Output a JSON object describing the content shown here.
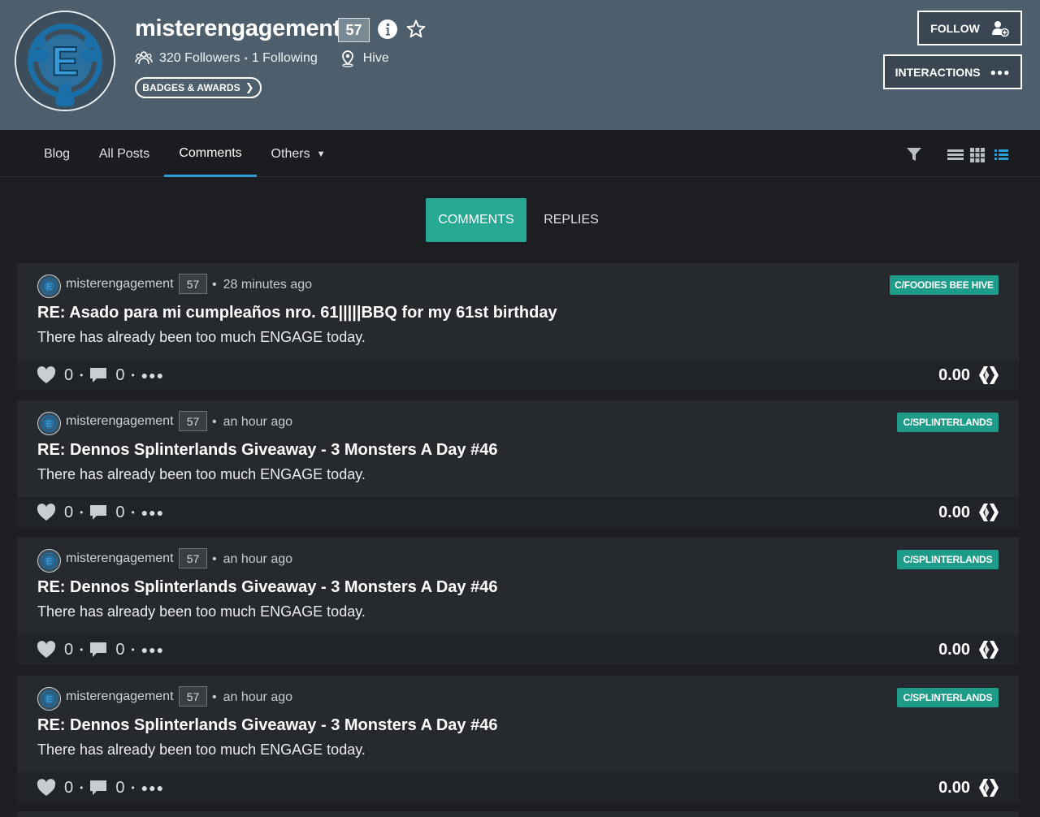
{
  "profile": {
    "username": "misterengagement",
    "reputation": "57",
    "followers": "320 Followers",
    "following": "1 Following",
    "location": "Hive",
    "badges_label": "BADGES & AWARDS",
    "follow_label": "FOLLOW",
    "interactions_label": "INTERACTIONS"
  },
  "nav": {
    "tabs": [
      {
        "label": "Blog"
      },
      {
        "label": "All Posts"
      },
      {
        "label": "Comments"
      },
      {
        "label": "Others"
      }
    ],
    "active_tab": "Comments"
  },
  "toggle": {
    "comments_label": "COMMENTS",
    "replies_label": "REPLIES",
    "active": "COMMENTS"
  },
  "comments": [
    {
      "author": "misterengagement",
      "reputation": "57",
      "time": "28 minutes ago",
      "community": "C/FOODIES BEE HIVE",
      "title": "RE: Asado para mi cumpleaños nro. 61|||||BBQ for my 61st birthday",
      "body": "There has already been too much ENGAGE today.",
      "votes": "0",
      "replies": "0",
      "payout": "0.00"
    },
    {
      "author": "misterengagement",
      "reputation": "57",
      "time": "an hour ago",
      "community": "C/SPLINTERLANDS",
      "title": "RE: Dennos Splinterlands Giveaway - 3 Monsters A Day #46",
      "body": "There has already been too much ENGAGE today.",
      "votes": "0",
      "replies": "0",
      "payout": "0.00"
    },
    {
      "author": "misterengagement",
      "reputation": "57",
      "time": "an hour ago",
      "community": "C/SPLINTERLANDS",
      "title": "RE: Dennos Splinterlands Giveaway - 3 Monsters A Day #46",
      "body": "There has already been too much ENGAGE today.",
      "votes": "0",
      "replies": "0",
      "payout": "0.00"
    },
    {
      "author": "misterengagement",
      "reputation": "57",
      "time": "an hour ago",
      "community": "C/SPLINTERLANDS",
      "title": "RE: Dennos Splinterlands Giveaway - 3 Monsters A Day #46",
      "body": "There has already been too much ENGAGE today.",
      "votes": "0",
      "replies": "0",
      "payout": "0.00"
    }
  ],
  "icons": {
    "info": "info-icon",
    "star": "star-icon",
    "followers": "followers-icon",
    "location": "location-pin-icon",
    "follow": "add-user-icon",
    "filter": "filter-icon",
    "heart": "heart-icon",
    "reply": "comment-bubble-icon",
    "hive": "hive-logo-icon"
  },
  "colors": {
    "header_bg": "#4d5f6c",
    "accent_teal": "#27a893",
    "active_tab": "#2c9ed4",
    "page_bg": "#1c1e22",
    "card_bg": "#26292e"
  }
}
